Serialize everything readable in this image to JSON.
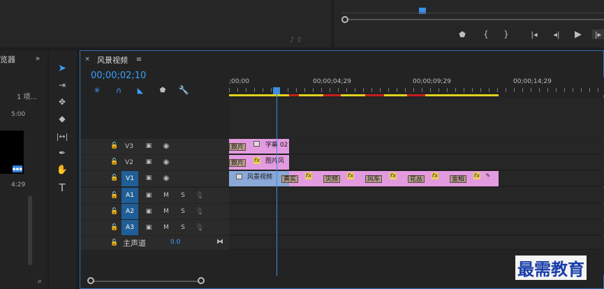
{
  "project_panel": {
    "tab_label": "览器",
    "item_count": "1 项...",
    "thumb_duration": "5:00",
    "thumb_duration2": "4:29"
  },
  "sequence": {
    "title": "风景视频",
    "timecode": "00;00;02;10",
    "ruler_labels": [
      ";00;00",
      "00;00;04;29",
      "00;00;09;29",
      "00;00;14;29"
    ]
  },
  "tracks": {
    "video": [
      {
        "name": "V3",
        "selected": false
      },
      {
        "name": "V2",
        "selected": false
      },
      {
        "name": "V1",
        "selected": true
      }
    ],
    "audio": [
      {
        "name": "A1",
        "m": "M",
        "s": "S"
      },
      {
        "name": "A2",
        "m": "M",
        "s": "S"
      },
      {
        "name": "A3",
        "m": "M",
        "s": "S"
      }
    ],
    "master": {
      "label": "主声道",
      "value": "0.0"
    }
  },
  "clips": {
    "v3_tag": "致片",
    "v3_title": "字幕 02",
    "v2_tag": "致片",
    "v2_fx": "fx",
    "v2_title": "图片风",
    "v1_main": "风景视频",
    "v1_tags": [
      "黄实",
      "灾频",
      "风车",
      "花丛",
      "金柏"
    ],
    "fx": "fx"
  },
  "watermark": "最需教育"
}
